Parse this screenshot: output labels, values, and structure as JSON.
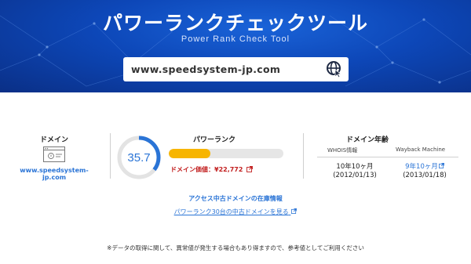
{
  "header": {
    "title": "パワーランクチェックツール",
    "subtitle": "Power Rank Check Tool",
    "search_value": "www.speedsystem-jp.com"
  },
  "domain_panel": {
    "label": "ドメイン",
    "domain": "www.speedsystem-jp.com"
  },
  "rank_panel": {
    "label": "パワーランク",
    "score": "35.7",
    "score_fraction": 0.357,
    "bar_fraction": 0.36,
    "price_text": "ドメイン価値：¥22,772"
  },
  "age_panel": {
    "label": "ドメイン年齢",
    "whois_header": "WHOIS情報",
    "wayback_header": "Wayback Machine",
    "whois_age": "10年10ヶ月",
    "whois_date": "(2012/01/13)",
    "wayback_age": "9年10ヶ月",
    "wayback_date": "(2013/01/18)"
  },
  "links": {
    "stock_title": "アクセス中古ドメインの在庫情報",
    "stock_link": "パワーランク30台の中古ドメインを見る"
  },
  "notice": "※データの取得に関して、異常値が発生する場合もあり得ますので、参考値としてご利用ください",
  "colors": {
    "header_blue": "#0d47b8",
    "link_blue": "#2a74d6",
    "gauge_blue": "#2a74d6",
    "bar_yellow": "#f7b500",
    "price_red": "#c21f1f"
  }
}
